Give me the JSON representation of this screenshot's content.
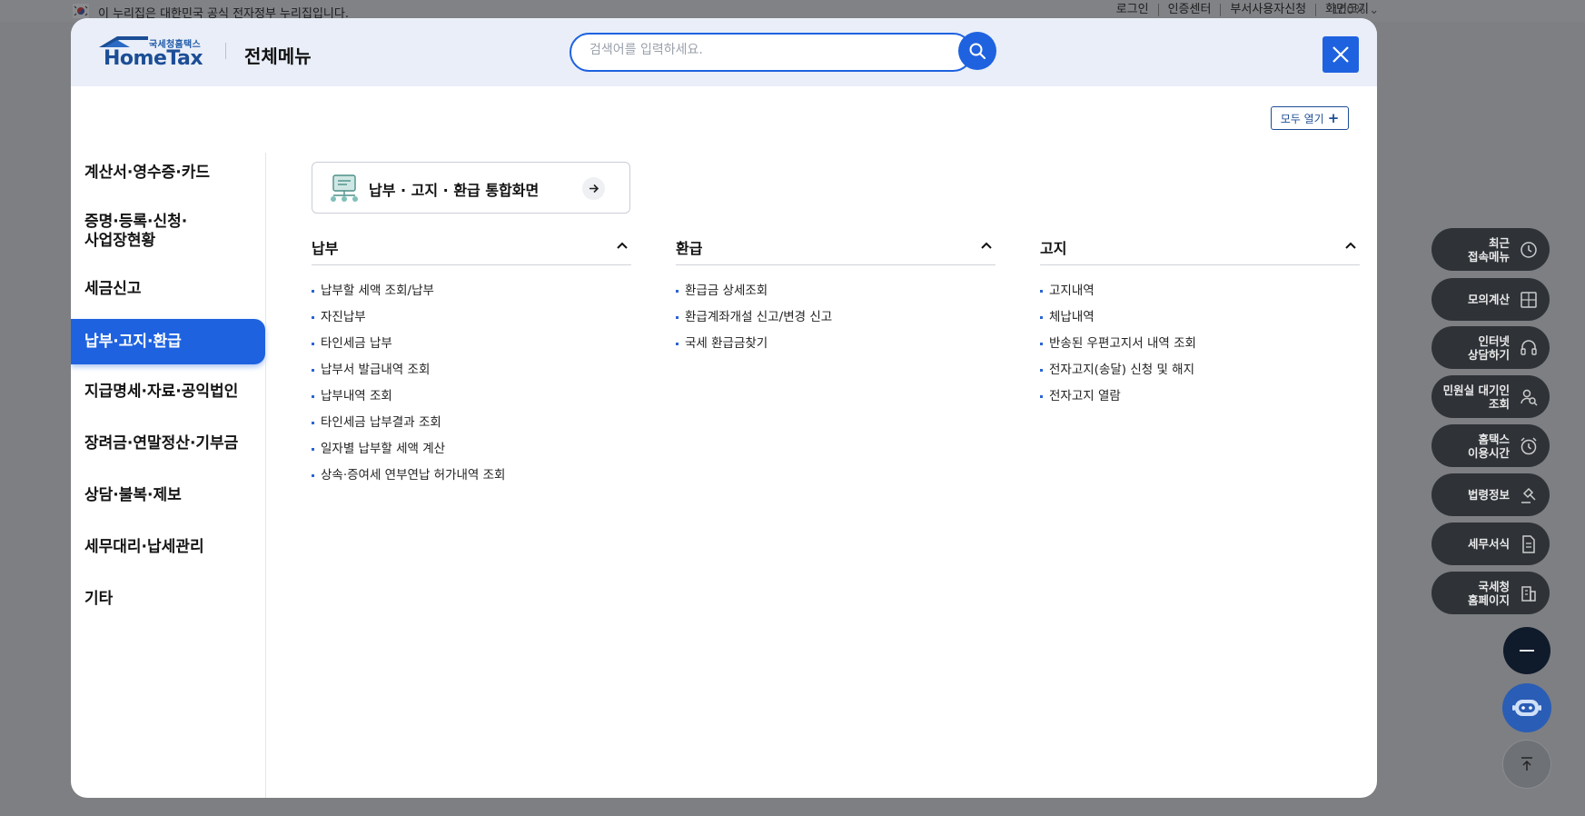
{
  "gov_strip": {
    "notice": "이 누리집은 대한민국 공식 전자정부 누리집입니다.",
    "links": [
      "로그인",
      "인증센터",
      "부서사용자신청",
      "화면크기"
    ],
    "zoom": "100%"
  },
  "header": {
    "logo_sub": "국세청홈택스",
    "logo_main": "HomeTax",
    "title": "전체메뉴",
    "search_placeholder": "검색어를 입력하세요."
  },
  "expand_all_label": "모두 열기",
  "sidebar": {
    "items": [
      {
        "label": "계산서·영수증·카드"
      },
      {
        "label": "증명·등록·신청·\n사업장현황"
      },
      {
        "label": "세금신고"
      },
      {
        "label": "납부·고지·환급"
      },
      {
        "label": "지급명세·자료·공익법인"
      },
      {
        "label": "장려금·연말정산·기부금"
      },
      {
        "label": "상담·불복·제보"
      },
      {
        "label": "세무대리·납세관리"
      },
      {
        "label": "기타"
      }
    ],
    "active_index": 3
  },
  "shortcut_label": "납부 · 고지 · 환급 통합화면",
  "columns": [
    {
      "title": "납부",
      "items": [
        "납부할 세액 조회/납부",
        "자진납부",
        "타인세금 납부",
        "납부서 발급내역 조회",
        "납부내역 조회",
        "타인세금 납부결과 조회",
        "일자별 납부할 세액 계산",
        "상속·증여세 연부연납 허가내역 조회"
      ]
    },
    {
      "title": "환급",
      "items": [
        "환급금 상세조회",
        "환급계좌개설 신고/변경 신고",
        "국세 환급금찾기"
      ]
    },
    {
      "title": "고지",
      "items": [
        "고지내역",
        "체납내역",
        "반송된 우편고지서 내역 조회",
        "전자고지(송달) 신청 및 해지",
        "전자고지 열람"
      ]
    }
  ],
  "quick_menu": [
    {
      "label": "최근\n접속메뉴",
      "icon": "clock-icon"
    },
    {
      "label": "모의계산",
      "icon": "calculator-icon"
    },
    {
      "label": "인터넷\n상담하기",
      "icon": "headset-icon"
    },
    {
      "label": "민원실 대기인\n조회",
      "icon": "people-search-icon"
    },
    {
      "label": "홈택스\n이용시간",
      "icon": "alarm-icon"
    },
    {
      "label": "법령정보",
      "icon": "gavel-icon"
    },
    {
      "label": "세무서식",
      "icon": "document-icon"
    },
    {
      "label": "국세청\n홈페이지",
      "icon": "building-icon"
    }
  ],
  "colors": {
    "accent": "#1e62e0",
    "brand": "#1c4e96",
    "header_bg": "#e9eef8"
  }
}
